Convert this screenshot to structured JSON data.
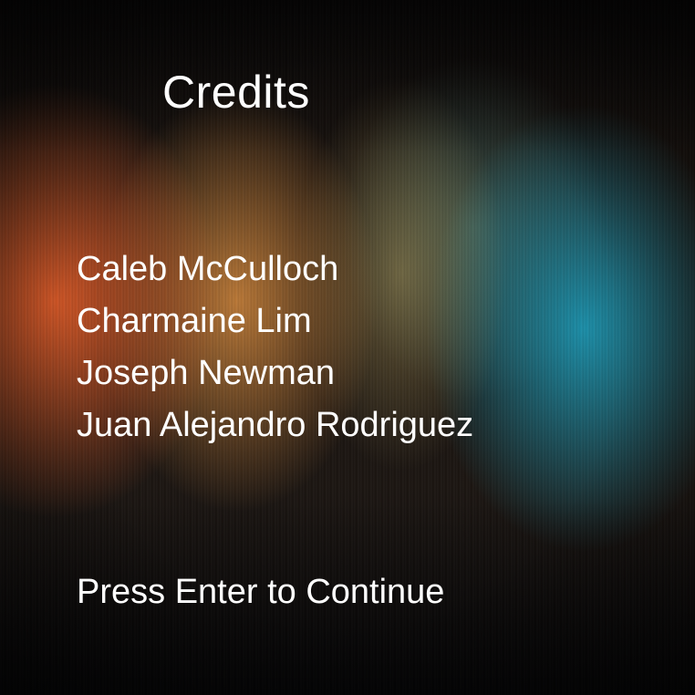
{
  "screen": {
    "title": "Credits",
    "names": [
      "Caleb McCulloch",
      "Charmaine Lim",
      "Joseph Newman",
      "Juan Alejandro Rodriguez"
    ],
    "prompt": "Press Enter to Continue"
  },
  "colors": {
    "text": "#ffffff",
    "warm_accent": "#e25c28",
    "cool_accent": "#1c96b2"
  }
}
